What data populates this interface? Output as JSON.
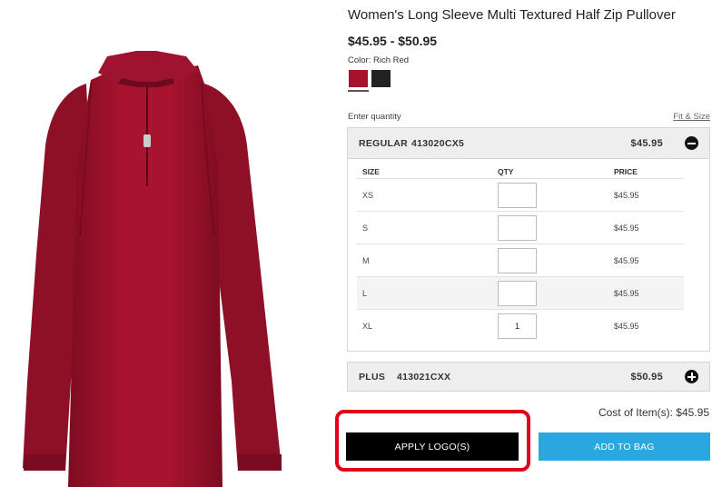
{
  "product": {
    "title": "Women's Long Sleeve Multi Textured Half Zip Pullover",
    "price_range": "$45.95 - $50.95",
    "color_label": "Color: Rich Red",
    "swatches": [
      {
        "name": "Rich Red",
        "color": "#a4122d",
        "selected": true
      },
      {
        "name": "Black",
        "color": "#222222",
        "selected": false
      }
    ]
  },
  "quantity": {
    "enter_label": "Enter quantity",
    "fit_size_link": "Fit & Size"
  },
  "regular": {
    "name": "REGULAR",
    "sku": "413020CX5",
    "price": "$45.95",
    "headers": {
      "size": "SIZE",
      "qty": "QTY",
      "price": "PRICE"
    },
    "rows": [
      {
        "size": "XS",
        "qty": "",
        "price": "$45.95"
      },
      {
        "size": "S",
        "qty": "",
        "price": "$45.95"
      },
      {
        "size": "M",
        "qty": "",
        "price": "$45.95"
      },
      {
        "size": "L",
        "qty": "",
        "price": "$45.95"
      },
      {
        "size": "XL",
        "qty": "1",
        "price": "$45.95"
      }
    ]
  },
  "plus": {
    "name": "PLUS",
    "sku": "413021CXX",
    "price": "$50.95"
  },
  "cost": "Cost of Item(s): $45.95",
  "buttons": {
    "apply_logo": "APPLY LOGO(S)",
    "add_to_bag": "ADD TO BAG"
  },
  "colors": {
    "garment": "#a4122d",
    "highlight": "#e0001b",
    "add_to_bag": "#28a8de"
  }
}
